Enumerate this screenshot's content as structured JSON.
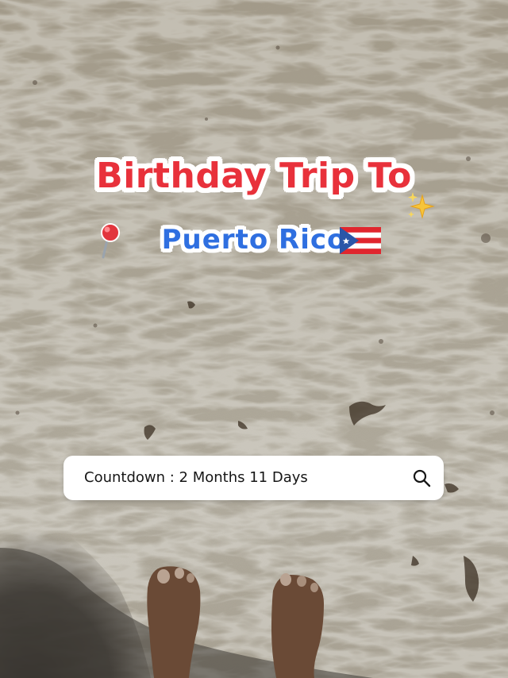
{
  "overlay": {
    "title_line1": "Birthday Trip To",
    "title_line2": "Puerto Rico",
    "title_color": "#e8313b",
    "subtitle_color": "#2f6fe0"
  },
  "icons": {
    "pin": "round-pushpin-icon",
    "flag": "puerto-rico-flag-icon",
    "sparkle": "sparkles-icon",
    "search": "search-icon"
  },
  "search_bar": {
    "text": "Countdown : 2 Months 11 Days"
  }
}
